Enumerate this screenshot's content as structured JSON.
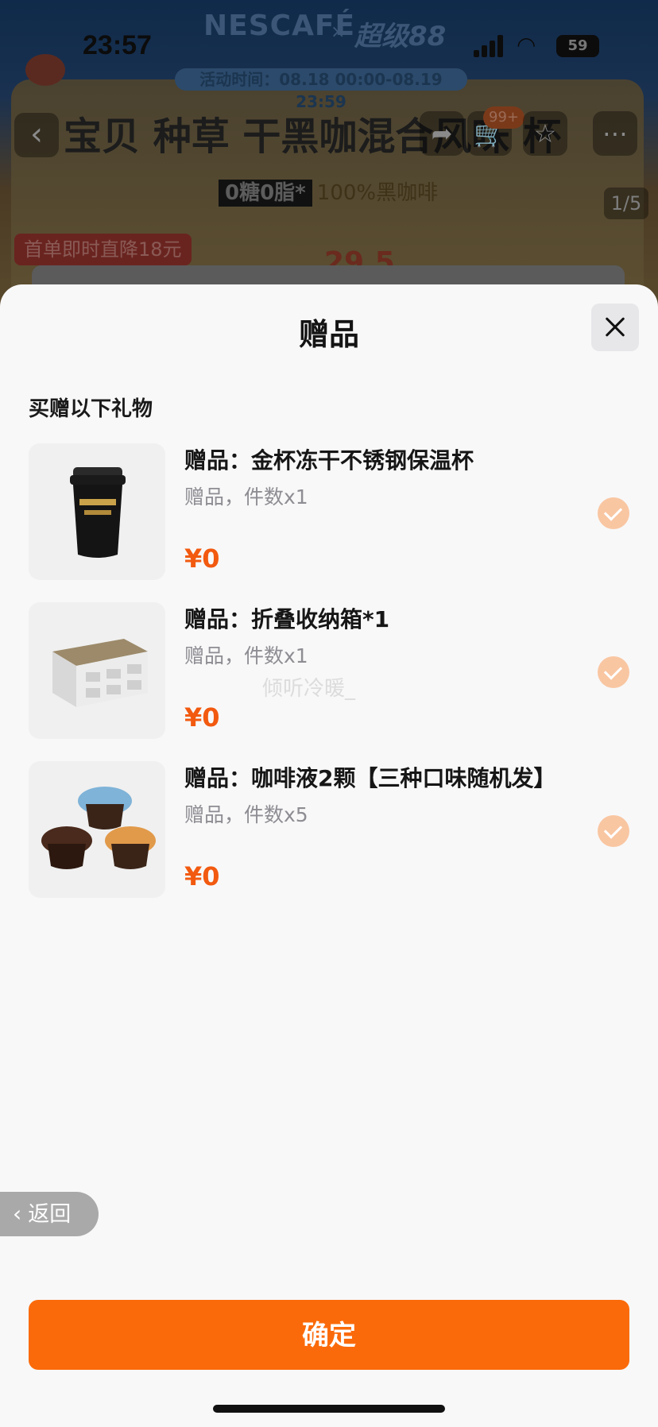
{
  "background_page": {
    "status_time": "23:57",
    "battery": "59",
    "brand_left": "NESCAFÉ",
    "brand_x": "×",
    "brand_right": "超级88",
    "activity_time": "活动时间：08.18 00:00-08.19 23:59",
    "title": "宝贝 种草 干黑咖混合风味 杯",
    "cart_badge": "99+",
    "subtitle_bold": "0糖0脂*",
    "subtitle_text": "100%黑咖啡",
    "image_counter": "1/5",
    "promo": "首单即时直降18元",
    "price_fragment": "29.5"
  },
  "sheet": {
    "title": "赠品",
    "section_title": "买赠以下礼物",
    "gifts": [
      {
        "name": "赠品：金杯冻干不锈钢保温杯",
        "meta": "赠品，件数x1",
        "price": "¥0",
        "image": "black-tumbler"
      },
      {
        "name": "赠品：折叠收纳箱*1",
        "meta": "赠品，件数x1",
        "price": "¥0",
        "image": "folding-storage-box"
      },
      {
        "name": "赠品：咖啡液2颗【三种口味随机发】",
        "meta": "赠品，件数x5",
        "price": "¥0",
        "image": "coffee-capsules"
      }
    ],
    "watermark": "倾听冷暖_",
    "back_label": "返回",
    "confirm_label": "确定"
  },
  "colors": {
    "accent": "#fb6a0a",
    "price": "#f25a10",
    "check_bg": "#f9c6a2"
  }
}
